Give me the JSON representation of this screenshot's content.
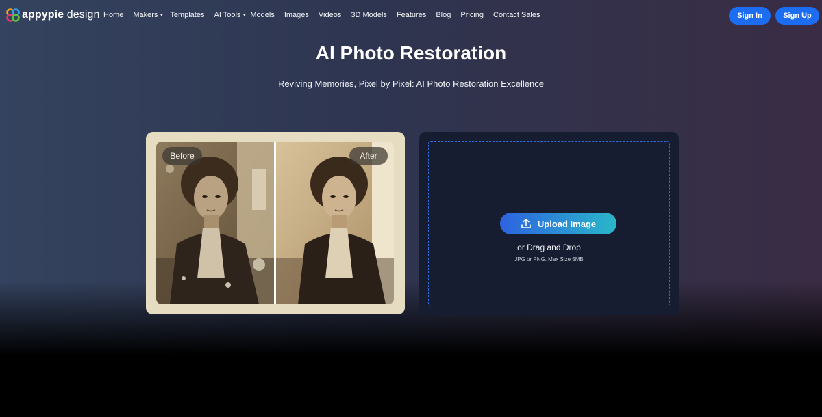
{
  "brand": {
    "name_bold": "appypie",
    "name_light": " design"
  },
  "nav": {
    "items": [
      {
        "label": "Home",
        "dropdown": false
      },
      {
        "label": "Makers",
        "dropdown": true
      },
      {
        "label": "Templates",
        "dropdown": false
      },
      {
        "label": "AI Tools",
        "dropdown": true
      },
      {
        "label": "Models",
        "dropdown": false
      },
      {
        "label": "Images",
        "dropdown": false
      },
      {
        "label": "Videos",
        "dropdown": false
      },
      {
        "label": "3D Models",
        "dropdown": false
      },
      {
        "label": "Features",
        "dropdown": false
      },
      {
        "label": "Blog",
        "dropdown": false
      },
      {
        "label": "Pricing",
        "dropdown": false
      },
      {
        "label": "Contact Sales",
        "dropdown": false
      }
    ],
    "sign_in": "Sign In",
    "sign_up": "Sign Up"
  },
  "hero": {
    "title": "AI Photo Restoration",
    "subtitle": "Reviving Memories, Pixel by Pixel: AI Photo Restoration Excellence"
  },
  "compare": {
    "before_label": "Before",
    "after_label": "After"
  },
  "upload": {
    "button_label": "Upload Image",
    "drag_text": "or Drag and Drop",
    "hint": "JPG or PNG. Max Size 5MB"
  },
  "colors": {
    "primary_button": "#1c6df2",
    "upload_gradient_start": "#2d63e0",
    "upload_gradient_end": "#2ab7c9",
    "upload_card_bg": "#161d30",
    "compare_card_bg": "#e6dcc2"
  },
  "icons": {
    "upload": "upload-arrow-icon",
    "caret": "caret-down-icon",
    "logo": "appypie-logo-icon"
  }
}
